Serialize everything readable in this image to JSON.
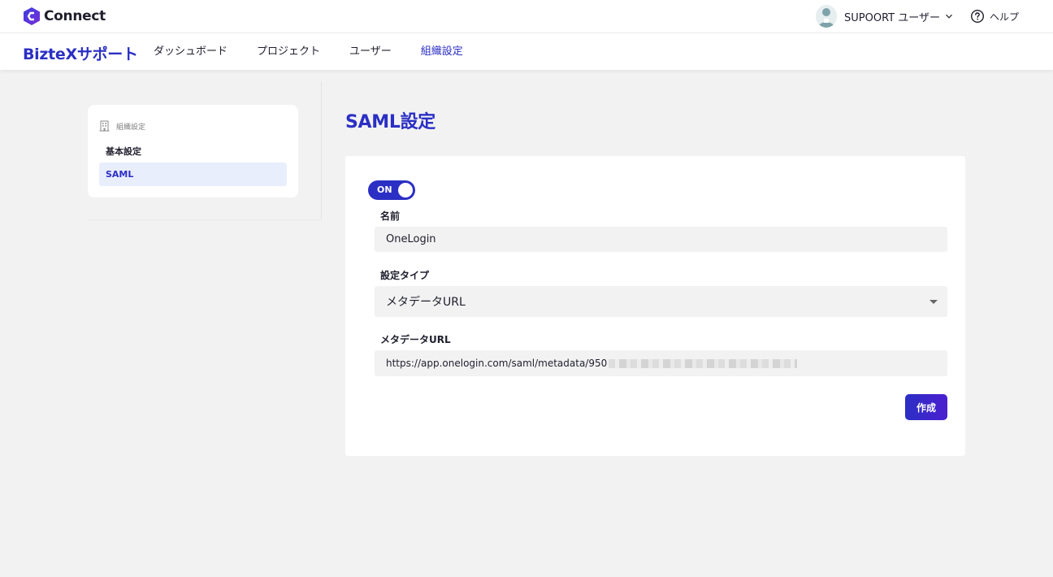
{
  "app": {
    "logo_text": "Connect",
    "brand": "BizteXサポート"
  },
  "header": {
    "user_name": "SUPOORT ユーザー",
    "help_label": "ヘルプ"
  },
  "nav": {
    "tabs": [
      {
        "label": "ダッシュボード",
        "active": false
      },
      {
        "label": "プロジェクト",
        "active": false
      },
      {
        "label": "ユーザー",
        "active": false
      },
      {
        "label": "組織設定",
        "active": true
      }
    ]
  },
  "sidebar": {
    "section_title": "組織設定",
    "items": [
      {
        "label": "基本設定",
        "active": false
      },
      {
        "label": "SAML",
        "active": true
      }
    ]
  },
  "main": {
    "title": "SAML設定",
    "toggle_label": "ON",
    "toggle_on": true,
    "fields": {
      "name": {
        "label": "名前",
        "value": "OneLogin"
      },
      "type": {
        "label": "設定タイプ",
        "value": "メタデータURL"
      },
      "metadata_url": {
        "label": "メタデータURL",
        "value": "https://app.onelogin.com/saml/metadata/950"
      }
    },
    "submit_label": "作成"
  },
  "colors": {
    "accent": "#2b2fc4",
    "active_bg": "#e9eefd",
    "page_bg": "#f2f2f2"
  },
  "icons": [
    "logo-mark-icon",
    "avatar-icon",
    "chevron-down-icon",
    "help-circle-icon",
    "building-icon",
    "caret-down-icon"
  ]
}
